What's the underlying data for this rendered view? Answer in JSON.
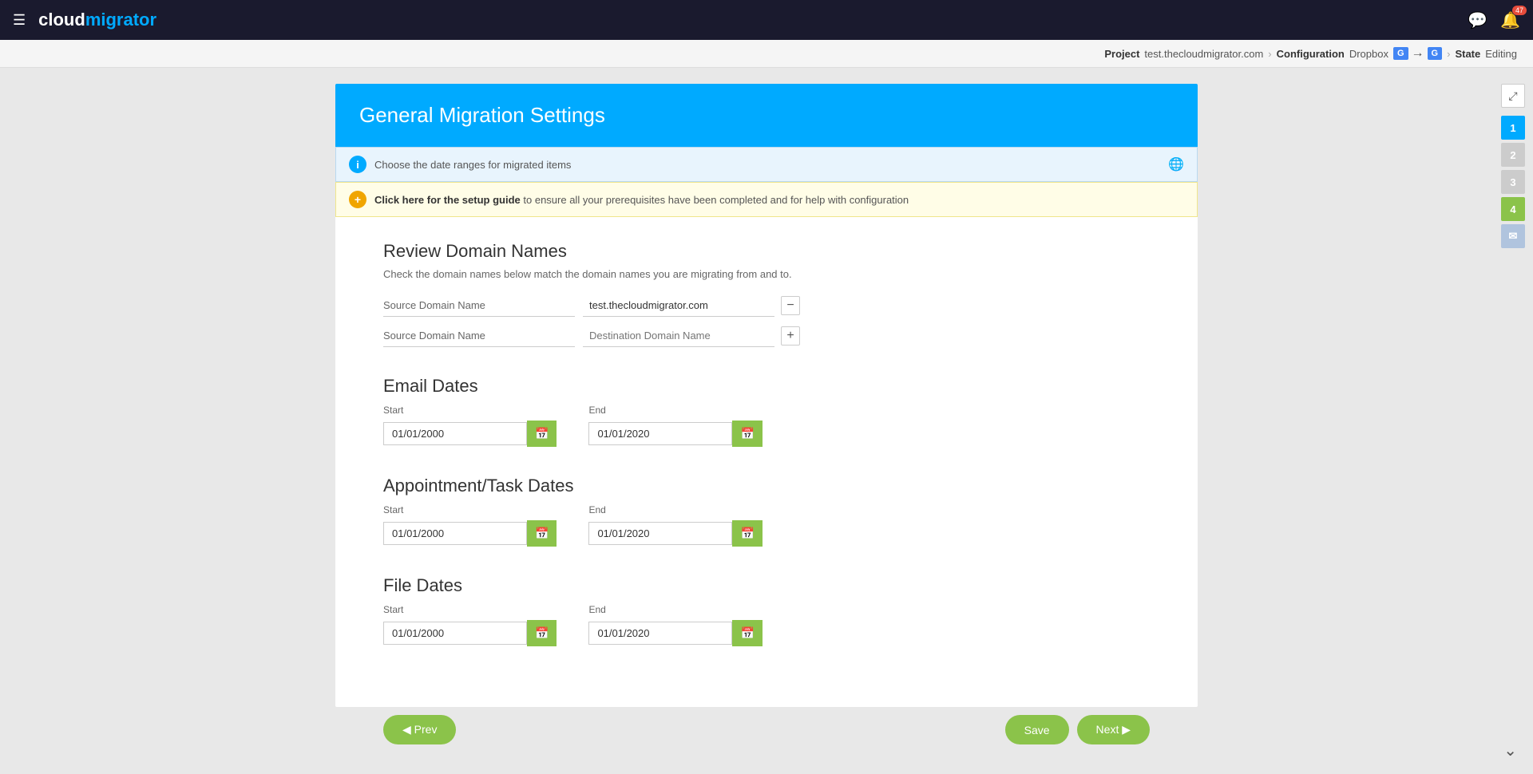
{
  "topnav": {
    "logo_cloud": "cloud",
    "logo_migrator": "migrator",
    "notification_count": "47"
  },
  "breadcrumb": {
    "project_label": "Project",
    "project_value": "test.thecloudmigrator.com",
    "config_label": "Configuration",
    "config_value": "Dropbox",
    "state_label": "State",
    "state_value": "Editing"
  },
  "header": {
    "title": "General Migration Settings"
  },
  "info_bar": {
    "text": "Choose the date ranges for migrated items"
  },
  "setup_bar": {
    "link_text": "Click here for the setup guide",
    "suffix_text": "to ensure all your prerequisites have been completed and for help with configuration"
  },
  "review_domain": {
    "title": "Review Domain Names",
    "description": "Check the domain names below match the domain names you are migrating from and to.",
    "row1": {
      "label": "Source Domain Name",
      "value": "test.thecloudmigrator.com"
    },
    "row2": {
      "label": "Source Domain Name",
      "value": "Destination Domain Name"
    }
  },
  "email_dates": {
    "title": "Email Dates",
    "start_label": "Start",
    "start_value": "01/01/2000",
    "end_label": "End",
    "end_value": "01/01/2020"
  },
  "appointment_dates": {
    "title": "Appointment/Task Dates",
    "start_label": "Start",
    "start_value": "01/01/2000",
    "end_label": "End",
    "end_value": "01/01/2020"
  },
  "file_dates": {
    "title": "File Dates",
    "start_label": "Start",
    "start_value": "01/01/2000",
    "end_label": "End",
    "end_value": "01/01/2020"
  },
  "steps": [
    "1",
    "2",
    "3",
    "4"
  ],
  "bottom": {
    "prev_label": "◀ Prev",
    "next_label": "Next ▶",
    "save_label": "Save"
  }
}
